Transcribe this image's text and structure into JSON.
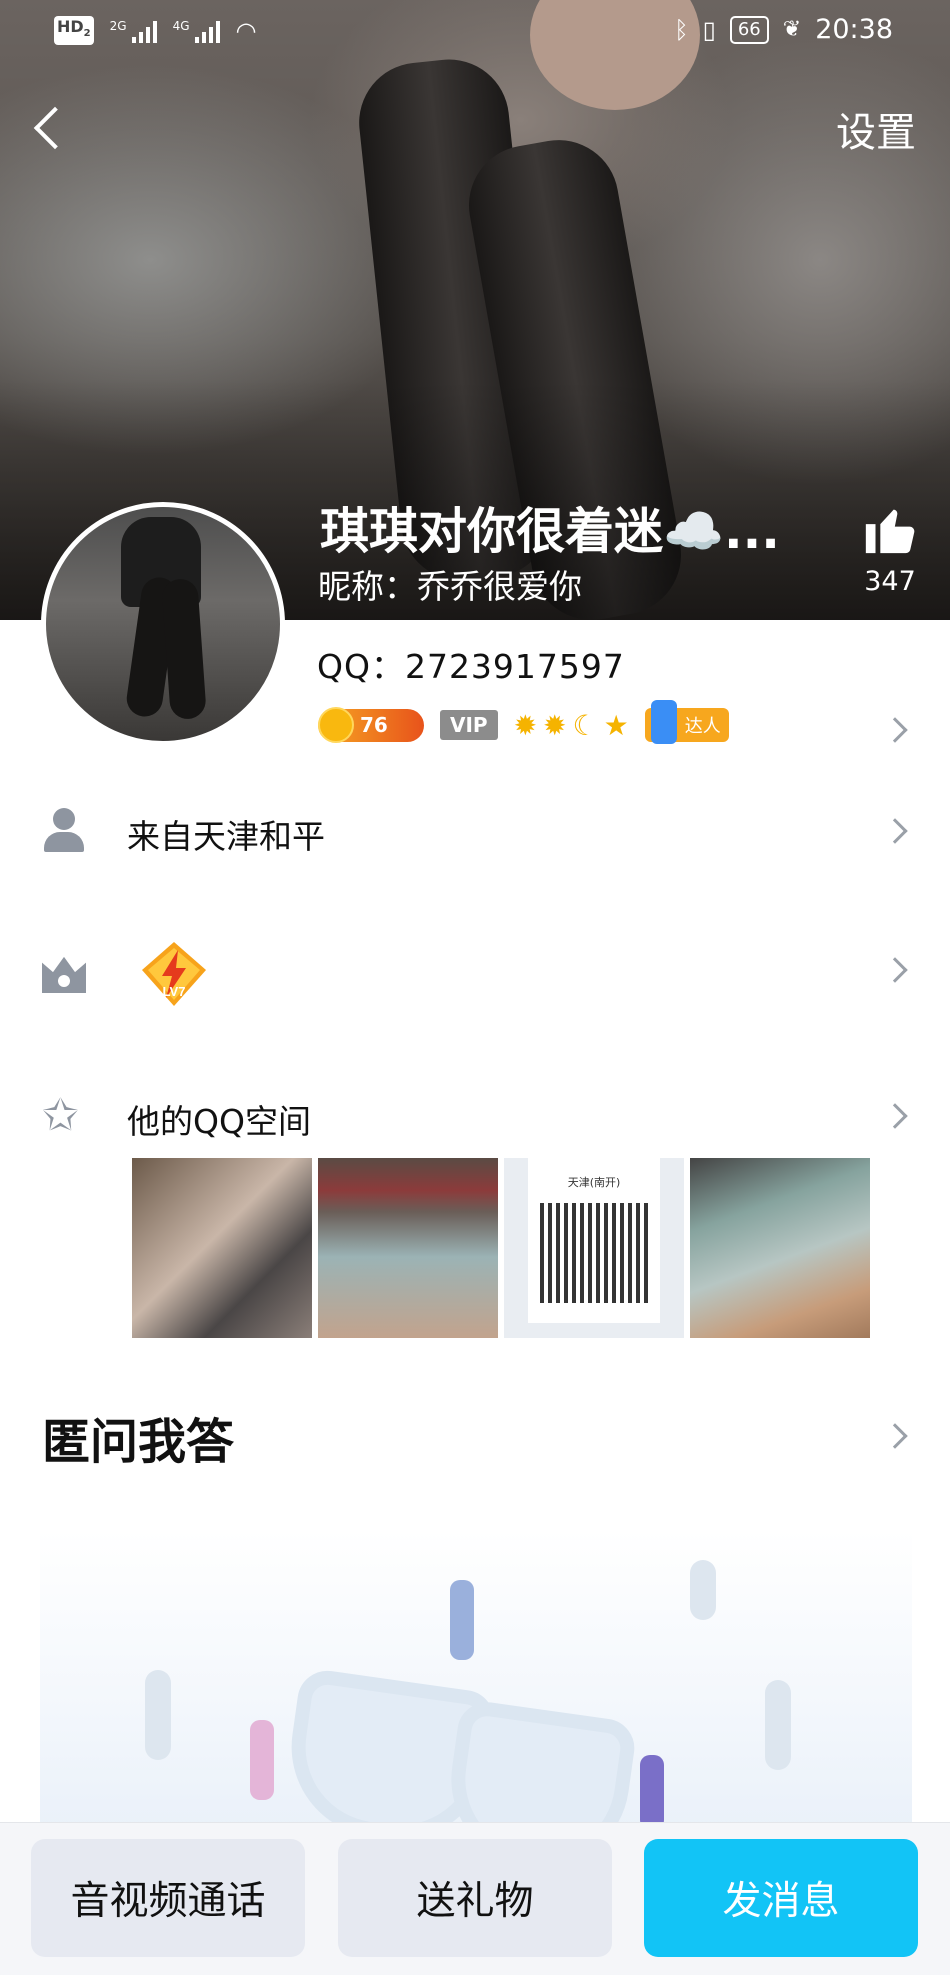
{
  "status_bar": {
    "hd_badge": "HD",
    "hd_sub": "2",
    "signal1_tag": "2G",
    "signal2_tag": "4G",
    "battery": "66",
    "time": "20:38"
  },
  "header": {
    "settings_label": "设置"
  },
  "profile": {
    "title": "琪琪对你很着迷☁️...",
    "nickname_line": "昵称：乔乔很爱你",
    "like_count": "347",
    "qq_line": "QQ：2723917597",
    "level_badge_value": "76",
    "vip_label": "VIP",
    "daren_label": "达人"
  },
  "rows": {
    "location_label": "来自天津和平",
    "game_level_label": "LV7",
    "qzone_label": "他的QQ空间"
  },
  "qzone_photos": {
    "qr_caption": "天津(南开)"
  },
  "section": {
    "qa_title": "匿问我答"
  },
  "bottom_bar": {
    "call_label": "音视频通话",
    "gift_label": "送礼物",
    "message_label": "发消息"
  }
}
